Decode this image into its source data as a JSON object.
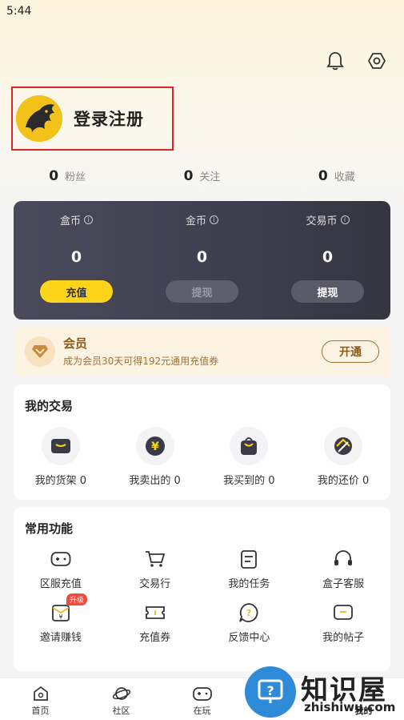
{
  "status_bar": {
    "time": "5:44"
  },
  "header": {
    "bell_icon": "bell-icon",
    "settings_icon": "settings-icon"
  },
  "profile": {
    "login_label": "登录注册"
  },
  "stats": [
    {
      "value": "0",
      "label": "粉丝"
    },
    {
      "value": "0",
      "label": "关注"
    },
    {
      "value": "0",
      "label": "收藏"
    }
  ],
  "wallet": {
    "cols": [
      {
        "label": "盒币",
        "value": "0",
        "button": "充值"
      },
      {
        "label": "金币",
        "value": "0",
        "button": "提现"
      },
      {
        "label": "交易币",
        "value": "0",
        "button": "提现"
      }
    ]
  },
  "vip": {
    "title": "会员",
    "subtitle": "成为会员30天可得192元通用充值券",
    "button": "开通"
  },
  "trade": {
    "title": "我的交易",
    "items": [
      {
        "label": "我的货架 0"
      },
      {
        "label": "我卖出的 0"
      },
      {
        "label": "我买到的 0"
      },
      {
        "label": "我的还价 0"
      }
    ]
  },
  "functions": {
    "title": "常用功能",
    "items": [
      {
        "label": "区服充值"
      },
      {
        "label": "交易行"
      },
      {
        "label": "我的任务"
      },
      {
        "label": "盒子客服"
      },
      {
        "label": "邀请赚钱",
        "badge": "升级"
      },
      {
        "label": "充值券"
      },
      {
        "label": "反馈中心"
      },
      {
        "label": "我的帖子"
      }
    ]
  },
  "tabbar": [
    {
      "label": "首页"
    },
    {
      "label": "社区"
    },
    {
      "label": "在玩"
    },
    {
      "label": ""
    },
    {
      "label": "我的"
    }
  ],
  "watermark": {
    "title": "知识屋",
    "sub": "zhishiwu.com"
  },
  "colors": {
    "accent": "#fcd41a",
    "vip": "#8a5a1c",
    "red": "#d9262b"
  }
}
